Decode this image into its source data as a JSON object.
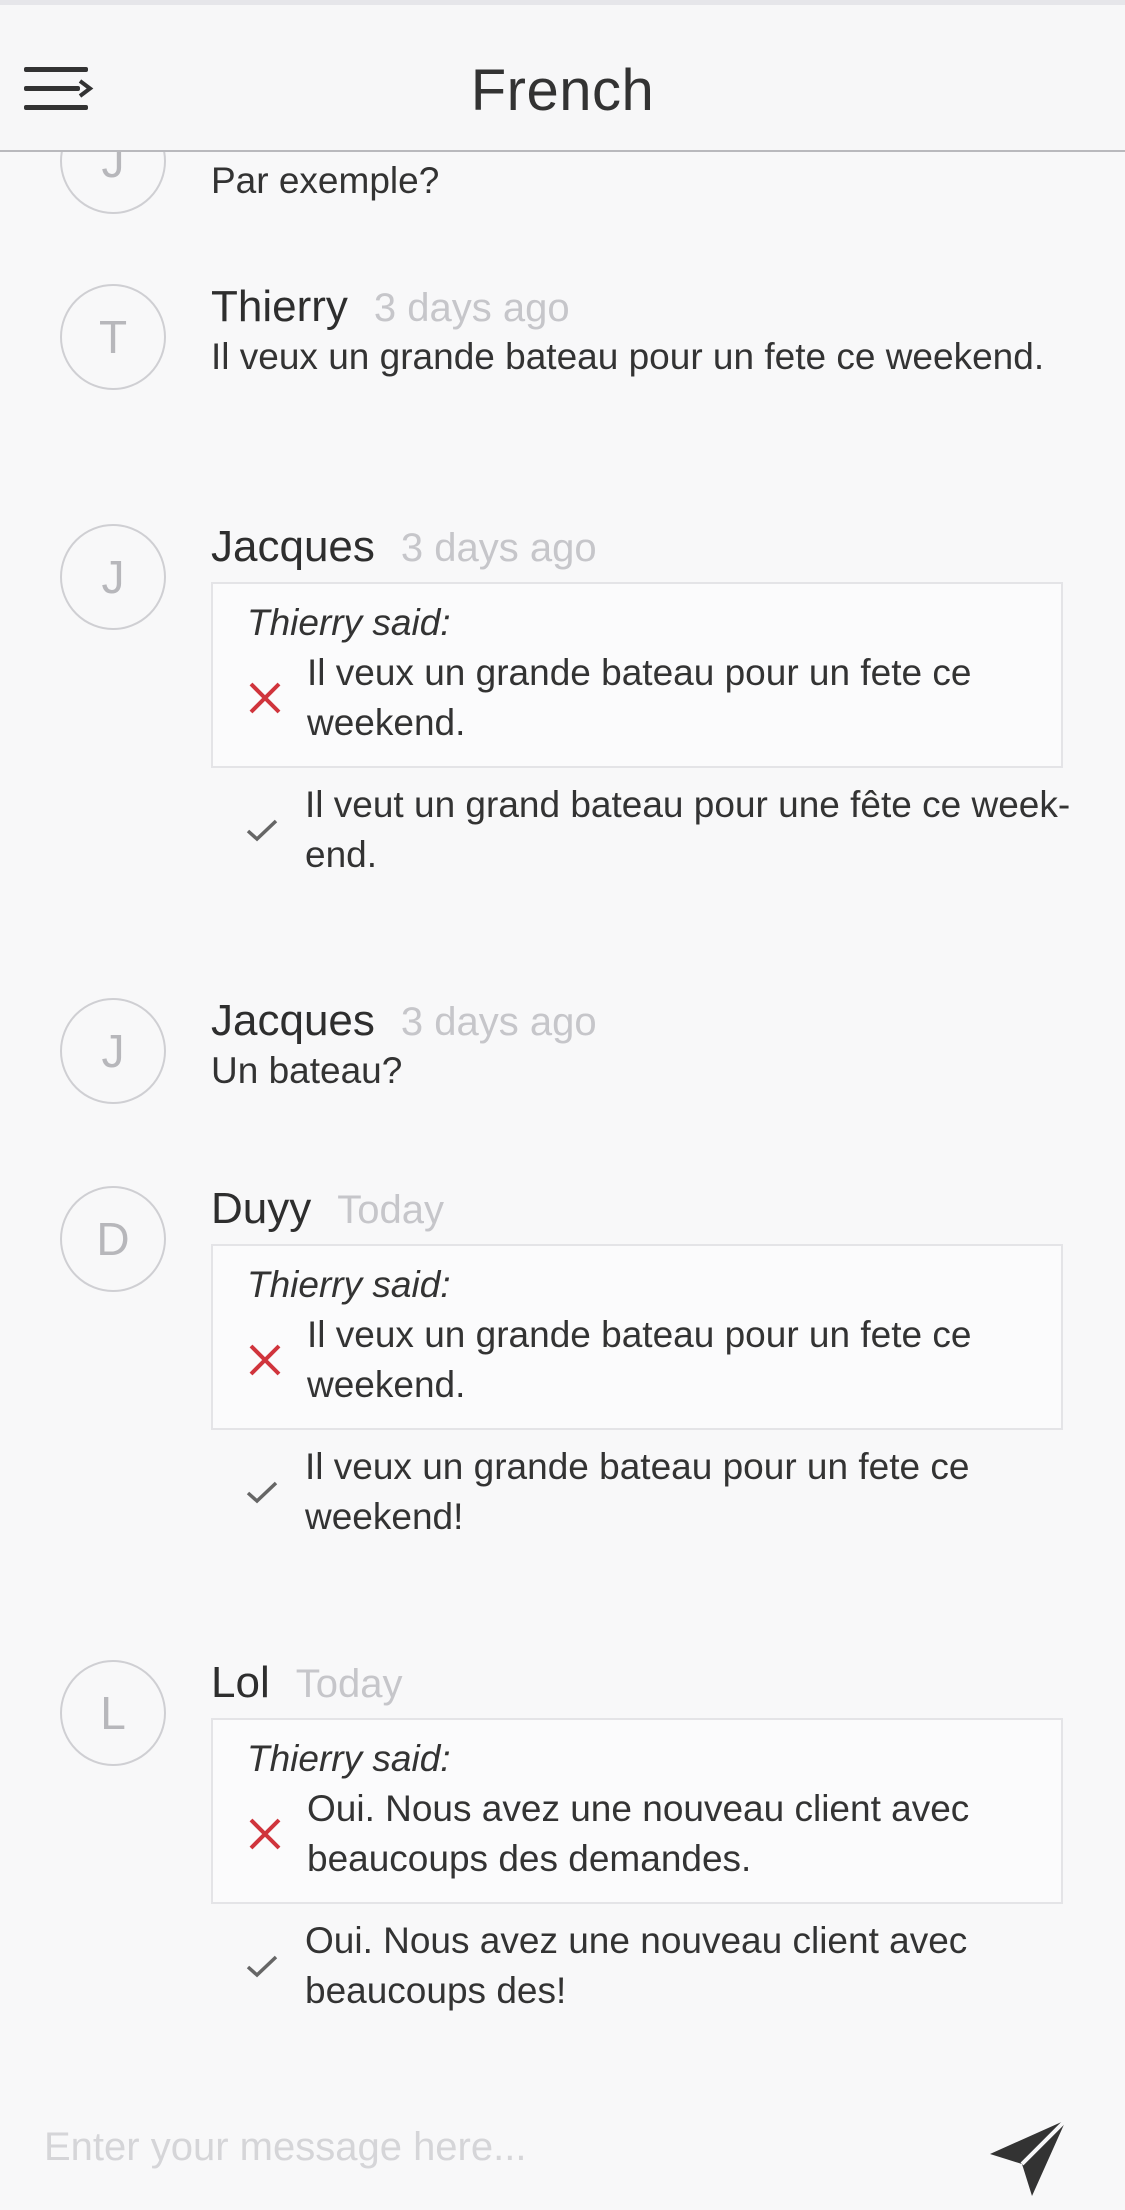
{
  "header": {
    "title": "French"
  },
  "messages": [
    {
      "initial": "J",
      "text": "Par exemple?"
    },
    {
      "initial": "T",
      "name": "Thierry",
      "time": "3 days ago",
      "text": "Il veux un grande bateau pour un fete ce weekend."
    },
    {
      "initial": "J",
      "name": "Jacques",
      "time": "3 days ago",
      "quote_label": "Thierry said:",
      "original": "Il veux un grande bateau pour un fete ce weekend.",
      "corrected": "Il veut un grand bateau pour une fête ce week-end."
    },
    {
      "initial": "J",
      "name": "Jacques",
      "time": "3 days ago",
      "text": "Un bateau?"
    },
    {
      "initial": "D",
      "name": "Duyy",
      "time": "Today",
      "quote_label": "Thierry said:",
      "original": "Il veux un grande bateau pour un fete ce weekend.",
      "corrected": "Il veux un grande bateau pour un fete ce weekend!"
    },
    {
      "initial": "L",
      "name": "Lol",
      "time": "Today",
      "quote_label": "Thierry said:",
      "original": "Oui. Nous avez une nouveau client avec beaucoups des demandes.",
      "corrected": "Oui. Nous avez une nouveau client avec beaucoups des!"
    }
  ],
  "composer": {
    "placeholder": "Enter your message here..."
  },
  "icons": {
    "menu": "menu-icon",
    "wrong": "cross-icon",
    "right": "check-icon",
    "send": "send-icon"
  },
  "colors": {
    "wrong_mark": "#d0343c",
    "check_mark": "#666666",
    "timestamp": "#c6c6ca"
  }
}
